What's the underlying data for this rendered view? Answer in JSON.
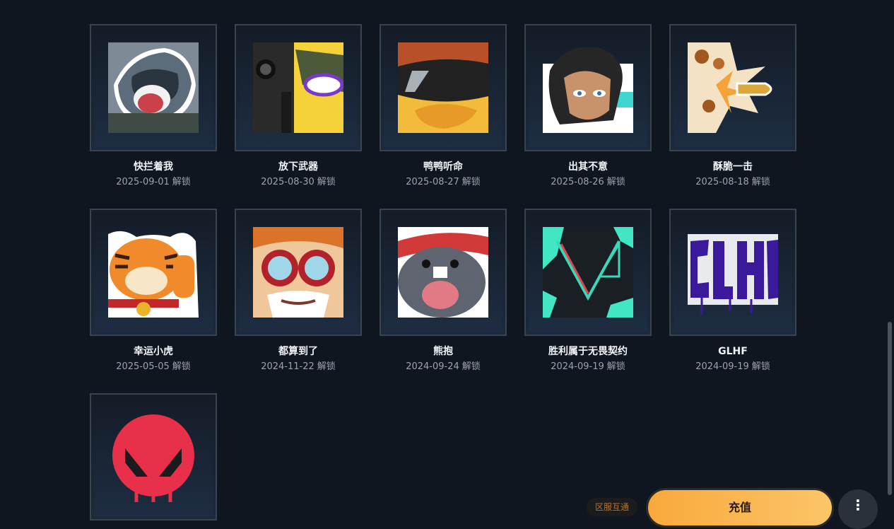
{
  "unlock_suffix": "解锁",
  "sprays": [
    {
      "name": "快拦着我",
      "date": "2025-09-01",
      "icon": "raccoon-sticker-icon"
    },
    {
      "name": "放下武器",
      "date": "2025-08-30",
      "icon": "duck-with-pistol-icon"
    },
    {
      "name": "鸭鸭听命",
      "date": "2025-08-27",
      "icon": "duck-sunglasses-icon"
    },
    {
      "name": "出其不意",
      "date": "2025-08-26",
      "icon": "agent-portrait-icon"
    },
    {
      "name": "酥脆一击",
      "date": "2025-08-18",
      "icon": "bullet-burst-icon"
    },
    {
      "name": "幸运小虎",
      "date": "2025-05-05",
      "icon": "lucky-tiger-icon"
    },
    {
      "name": "都算到了",
      "date": "2024-11-22",
      "icon": "goggles-face-icon"
    },
    {
      "name": "熊抱",
      "date": "2024-09-24",
      "icon": "crying-mole-icon"
    },
    {
      "name": "胜利属于无畏契约",
      "date": "2024-09-19",
      "icon": "valorant-logo-splatter-icon"
    },
    {
      "name": "GLHF",
      "date": "2024-09-19",
      "icon": "glhf-graffiti-icon"
    },
    {
      "name": "",
      "date": "",
      "icon": "valorant-red-emblem-icon"
    }
  ],
  "floating": {
    "pill_label": "区服互通",
    "cta_label": "充值"
  },
  "colors": {
    "background": "#0f1620",
    "card_border": "#3a4350",
    "cta": "#f9a93c"
  }
}
